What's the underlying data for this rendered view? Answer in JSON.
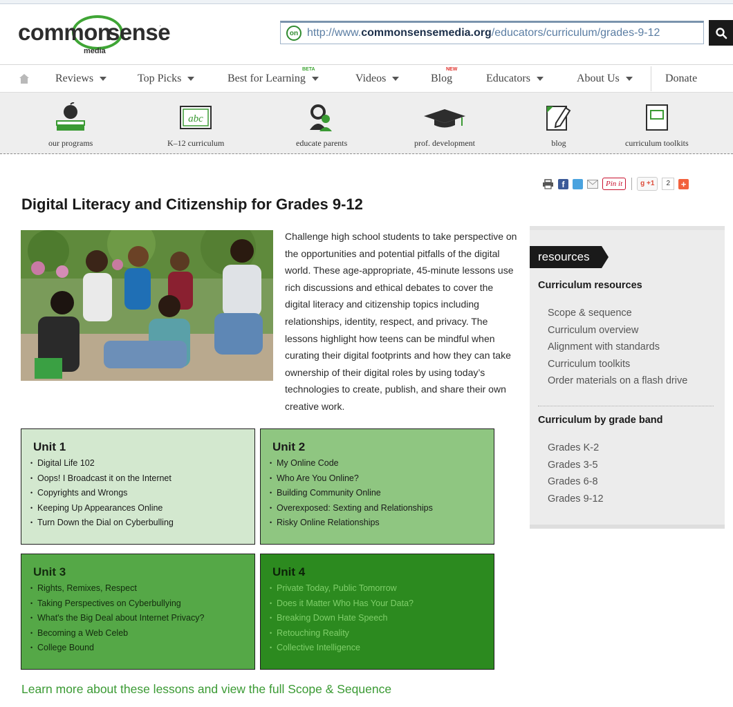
{
  "header": {
    "logo_part1": "common",
    "logo_part2": "sense",
    "logo_sub": "media",
    "logo_on_badge": "on",
    "url_prefix": "http://www.",
    "url_domain": "commonsensemedia.org",
    "url_path": "/educators/curriculum/grades-9-12"
  },
  "nav": {
    "items": [
      {
        "label": "Reviews"
      },
      {
        "label": "Top Picks"
      },
      {
        "label": "Best for Learning",
        "badge": "BETA"
      },
      {
        "label": "Videos"
      },
      {
        "label": "Blog",
        "badge": "NEW"
      },
      {
        "label": "Educators"
      },
      {
        "label": "About Us"
      },
      {
        "label": "Donate"
      }
    ]
  },
  "iconbar": {
    "items": [
      {
        "label": "our programs",
        "icon": "apple-books-icon"
      },
      {
        "label": "K–12 curriculum",
        "icon": "abc-board-icon"
      },
      {
        "label": "educate parents",
        "icon": "parents-icon"
      },
      {
        "label": "prof. development",
        "icon": "graduation-cap-icon"
      },
      {
        "label": "blog",
        "icon": "pencil-note-icon"
      },
      {
        "label": "curriculum toolkits",
        "icon": "toolkit-icon"
      }
    ]
  },
  "share": {
    "pinit": "Pin it",
    "gplus": "+1",
    "count": "2"
  },
  "page": {
    "title": "Digital Literacy and Citizenship for Grades 9-12",
    "intro": "Challenge high school students to take perspective on the opportunities and potential pitfalls of the digital world. These age-appropriate, 45-minute lessons use rich discussions and ethical debates to cover the digital literacy and citizenship topics including relationships, identity, respect, and privacy. The lessons highlight how teens can be mindful when curating their digital footprints and how they can take ownership of their digital roles by using today’s technologies to create, publish, and share their own creative work.",
    "learn_more": "Learn more about these lessons and view the full Scope & Sequence"
  },
  "units": [
    {
      "title": "Unit 1",
      "lessons": [
        "Digital Life 102",
        "Oops! I Broadcast it on the Internet",
        "Copyrights and Wrongs",
        "Keeping Up Appearances Online",
        "Turn Down the Dial on Cyberbulling"
      ]
    },
    {
      "title": "Unit 2",
      "lessons": [
        "My Online Code",
        "Who Are You Online?",
        "Building Community Online",
        "Overexposed: Sexting and Relationships",
        "Risky Online Relationships"
      ]
    },
    {
      "title": "Unit 3",
      "lessons": [
        "Rights, Remixes, Respect",
        "Taking Perspectives on Cyberbullying",
        "What's the Big Deal about Internet Privacy?",
        "Becoming a Web Celeb",
        "College Bound"
      ]
    },
    {
      "title": "Unit 4",
      "lessons": [
        "Private Today, Public Tomorrow",
        "Does it Matter Who Has Your Data?",
        "Breaking Down Hate Speech",
        "Retouching Reality",
        "Collective Intelligence"
      ]
    }
  ],
  "sidebar": {
    "tab": "resources",
    "section1_title": "Curriculum resources",
    "section1_links": [
      "Scope & sequence",
      "Curriculum overview",
      "Alignment with standards",
      "Curriculum toolkits",
      "Order materials on a flash drive"
    ],
    "section2_title": "Curriculum by grade band",
    "section2_links": [
      "Grades K-2",
      "Grades 3-5",
      "Grades 6-8",
      "Grades 9-12"
    ]
  },
  "colors": {
    "brand_green": "#3fa535",
    "unit1": "#d3e8cf",
    "unit2": "#8fc681",
    "unit3": "#55a847",
    "unit4": "#2c8a1f"
  }
}
